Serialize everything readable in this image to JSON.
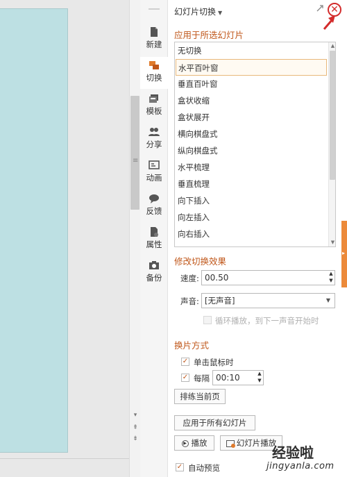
{
  "nav": {
    "items": [
      {
        "label": "新建",
        "icon": "new-file-icon"
      },
      {
        "label": "切换",
        "icon": "transition-icon"
      },
      {
        "label": "模板",
        "icon": "template-icon"
      },
      {
        "label": "分享",
        "icon": "share-icon"
      },
      {
        "label": "动画",
        "icon": "animation-icon"
      },
      {
        "label": "反馈",
        "icon": "feedback-icon"
      },
      {
        "label": "属性",
        "icon": "properties-icon"
      },
      {
        "label": "备份",
        "icon": "backup-icon"
      }
    ],
    "active": "切换"
  },
  "panel": {
    "title": "幻灯片切换",
    "apply_section": "应用于所选幻灯片",
    "effects": [
      "无切换",
      "水平百叶窗",
      "垂直百叶窗",
      "盒状收缩",
      "盒状展开",
      "横向棋盘式",
      "纵向棋盘式",
      "水平梳理",
      "垂直梳理",
      "向下插入",
      "向左插入",
      "向右插入"
    ],
    "selected_effect": "水平百叶窗",
    "modify_section": "修改切换效果",
    "speed_label": "速度:",
    "speed_value": "00.50",
    "sound_label": "声音:",
    "sound_value": "[无声音]",
    "loop_label": "循环播放，到下一声音开始时",
    "advance_section": "换片方式",
    "on_click_label": "单击鼠标时",
    "on_click_checked": true,
    "interval_label": "每隔",
    "interval_checked": true,
    "interval_value": "00:10",
    "rehearse_button": "排练当前页",
    "apply_all_button": "应用于所有幻灯片",
    "play_button": "播放",
    "slideshow_button": "幻灯片播放",
    "autopreview_label": "自动预览",
    "autopreview_checked": true
  },
  "watermark": {
    "line1": "经验啦",
    "line2": "jingyanla.com"
  },
  "colors": {
    "accent": "#c0571a",
    "slide_bg": "#bde0e3",
    "orange_tab": "#ec8a3a",
    "close_red": "#d32b2b"
  }
}
